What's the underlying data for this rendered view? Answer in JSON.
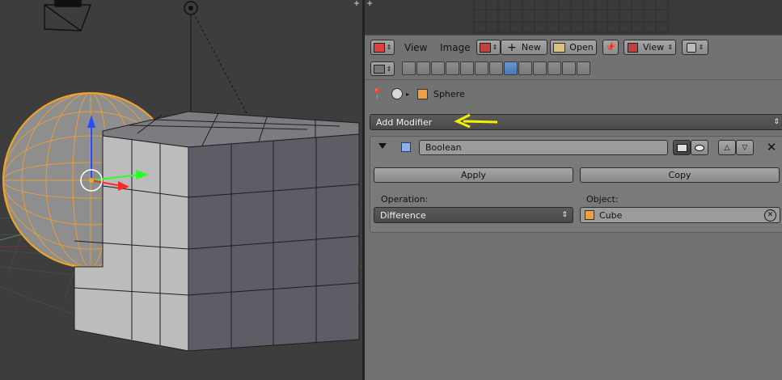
{
  "image_editor": {
    "menu": {
      "view": "View",
      "image": "Image"
    },
    "new_label": "New",
    "open_label": "Open",
    "view_dropdown": "View"
  },
  "breadcrumb": {
    "object_name": "Sphere"
  },
  "add_modifier_label": "Add Modifier",
  "modifier": {
    "name": "Boolean",
    "apply_label": "Apply",
    "copy_label": "Copy",
    "operation_label": "Operation:",
    "operation_value": "Difference",
    "object_label": "Object:",
    "object_value": "Cube"
  },
  "colors": {
    "viewport_bg": "#3d3d3d",
    "panel_bg": "#727272",
    "active_tab": "#5a86c5",
    "selected_outline": "#f5a623",
    "annotation_arrow": "#f2f200"
  }
}
